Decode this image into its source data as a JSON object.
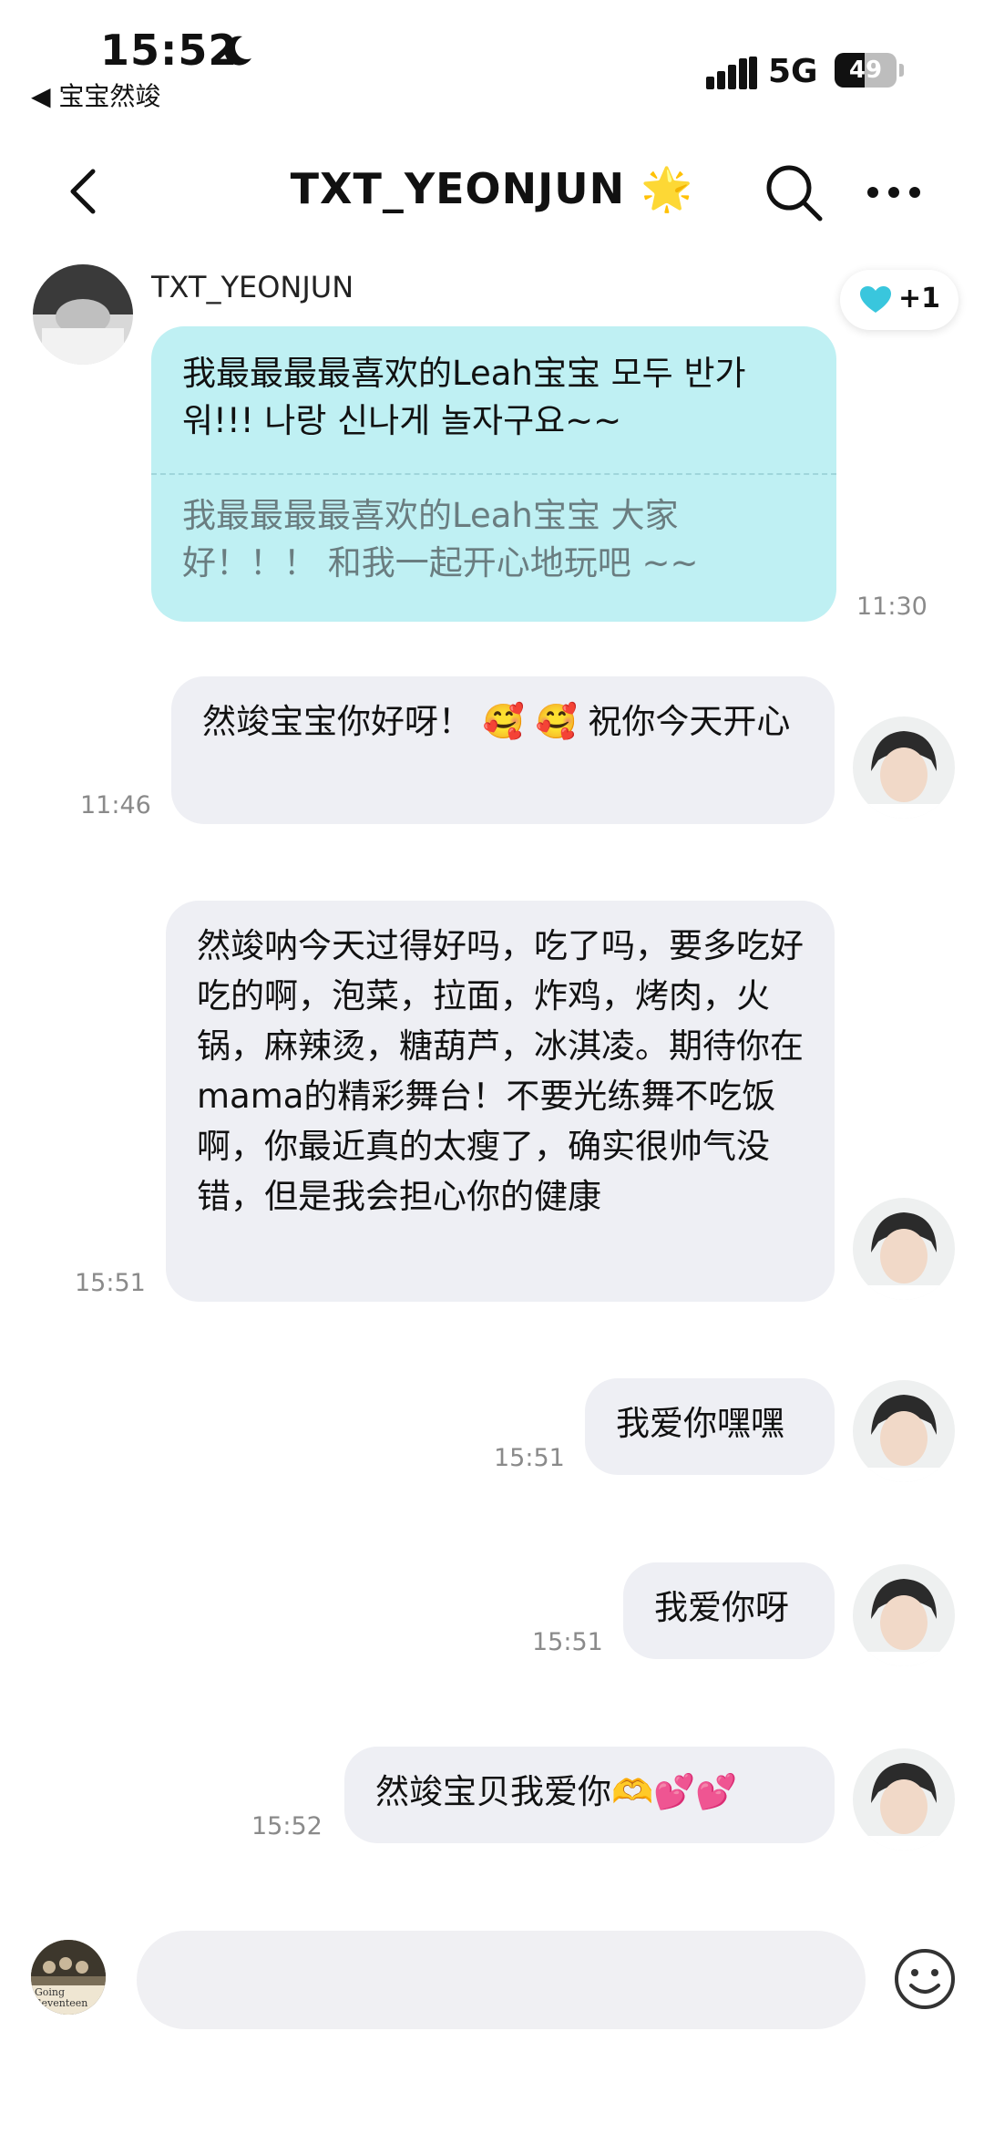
{
  "status_bar": {
    "time": "15:52",
    "back_app": "◀ 宝宝然竣",
    "network": "5G",
    "battery": "49",
    "battery_level": 0.49,
    "icons": [
      "moon-icon",
      "signal-bars-icon",
      "battery-icon"
    ]
  },
  "header": {
    "title": "TXT_YEONJUN 🌟",
    "icons": [
      "chevron-left-icon",
      "search-icon",
      "more-icon"
    ]
  },
  "messages": {
    "incoming": {
      "sender": "TXT_YEONJUN",
      "original": "我最最最最喜欢的Leah宝宝 모두 반가워!!! 나랑 신나게 놀자구요~~",
      "translation": "我最最最最喜欢的Leah宝宝 大家好！！！ 和我一起开心地玩吧 ~~",
      "time": "11:30",
      "reaction": {
        "icon": "heart-icon",
        "count": "+1",
        "color": "#39c6dd"
      }
    },
    "outgoing": [
      {
        "text": "然竣宝宝你好呀！ 🥰 🥰 祝你今天开心",
        "time": "11:46"
      },
      {
        "text": "然竣呐今天过得好吗，吃了吗，要多吃好吃的啊，泡菜，拉面，炸鸡，烤肉，火锅，麻辣烫，糖葫芦，冰淇凌。期待你在mama的精彩舞台！不要光练舞不吃饭啊，你最近真的太瘦了，确实很帅气没错，但是我会担心你的健康",
        "time": "15:51"
      },
      {
        "text": "我爱你嘿嘿",
        "time": "15:51"
      },
      {
        "text": "我爱你呀",
        "time": "15:51"
      },
      {
        "text": "然竣宝贝我爱你🫶💕💕",
        "time": "15:52"
      }
    ]
  },
  "input": {
    "avatar_caption": "Going Seventeen",
    "icons": [
      "emoji-icon"
    ]
  },
  "colors": {
    "incoming_bubble": "#bff0f3",
    "outgoing_bubble": "#eeeff4",
    "timestamp": "#8a8a8a"
  }
}
